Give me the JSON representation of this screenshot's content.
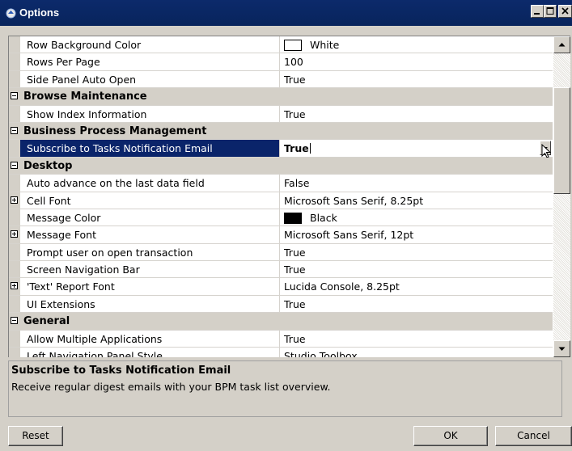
{
  "window": {
    "title": "Options"
  },
  "grid": {
    "rows": [
      {
        "type": "prop",
        "name": "Row Background Color",
        "value": "White",
        "swatch": "#ffffff"
      },
      {
        "type": "prop",
        "name": "Rows Per Page",
        "value": "100"
      },
      {
        "type": "prop",
        "name": "Side Panel Auto Open",
        "value": "True"
      },
      {
        "type": "category",
        "name": "Browse Maintenance"
      },
      {
        "type": "prop",
        "name": "Show Index Information",
        "value": "True"
      },
      {
        "type": "category",
        "name": "Business Process Management"
      },
      {
        "type": "prop",
        "name": "Subscribe to Tasks Notification Email",
        "value": "True",
        "selected": true
      },
      {
        "type": "category",
        "name": "Desktop"
      },
      {
        "type": "prop",
        "name": "Auto advance on the last data field",
        "value": "False"
      },
      {
        "type": "prop",
        "name": "Cell Font",
        "value": "Microsoft Sans Serif, 8.25pt",
        "expandable": true
      },
      {
        "type": "prop",
        "name": "Message Color",
        "value": "Black",
        "swatch": "#000000"
      },
      {
        "type": "prop",
        "name": "Message Font",
        "value": "Microsoft Sans Serif, 12pt",
        "expandable": true
      },
      {
        "type": "prop",
        "name": "Prompt user on open transaction",
        "value": "True"
      },
      {
        "type": "prop",
        "name": "Screen Navigation Bar",
        "value": "True"
      },
      {
        "type": "prop",
        "name": "'Text' Report Font",
        "value": "Lucida Console, 8.25pt",
        "expandable": true
      },
      {
        "type": "prop",
        "name": "UI Extensions",
        "value": "True"
      },
      {
        "type": "category",
        "name": "General"
      },
      {
        "type": "prop",
        "name": "Allow Multiple Applications",
        "value": "True"
      },
      {
        "type": "prop",
        "name": "Left Navigation Panel Style",
        "value": "Studio Toolbox"
      }
    ]
  },
  "help": {
    "title": "Subscribe to Tasks Notification Email",
    "description": "Receive regular digest emails with your BPM task list overview."
  },
  "buttons": {
    "reset": "Reset",
    "ok": "OK",
    "cancel": "Cancel"
  },
  "colors": {
    "titlebar": "#0c2a6b",
    "selection": "#0a246a",
    "face": "#d4d0c8"
  }
}
